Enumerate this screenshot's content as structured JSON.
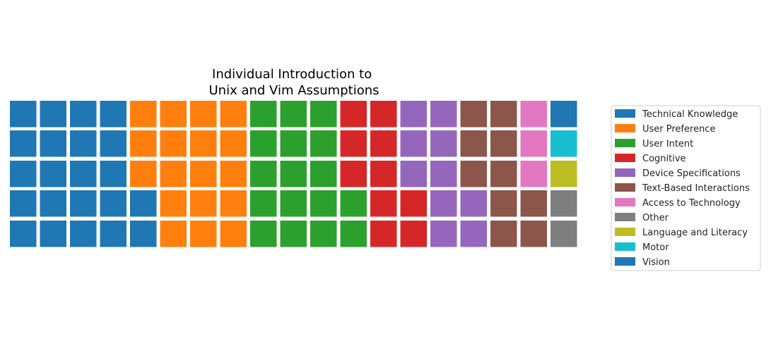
{
  "chart_data": {
    "type": "waffle",
    "title": "Individual Introduction to\nUnix and Vim Assumptions",
    "rows": 5,
    "columns": 19,
    "categories": [
      {
        "name": "Technical Knowledge",
        "value": 22,
        "color": "#1f77b4"
      },
      {
        "name": "User Preference",
        "value": 18,
        "color": "#ff7f0e"
      },
      {
        "name": "User Intent",
        "value": 17,
        "color": "#2ca02c"
      },
      {
        "name": "Cognitive",
        "value": 10,
        "color": "#d62728"
      },
      {
        "name": "Device Specifications",
        "value": 10,
        "color": "#9467bd"
      },
      {
        "name": "Text-Based Interactions",
        "value": 10,
        "color": "#8c564b"
      },
      {
        "name": "Access to Technology",
        "value": 3,
        "color": "#e377c2"
      },
      {
        "name": "Other",
        "value": 2,
        "color": "#7f7f7f"
      },
      {
        "name": "Language and Literacy",
        "value": 1,
        "color": "#bcbd22"
      },
      {
        "name": "Motor",
        "value": 1,
        "color": "#17becf"
      },
      {
        "name": "Vision",
        "value": 1,
        "color": "#1f77b4"
      }
    ],
    "fill_order": "column-major, bottom-to-top, left-to-right",
    "grid": false,
    "legend_position": "right"
  }
}
